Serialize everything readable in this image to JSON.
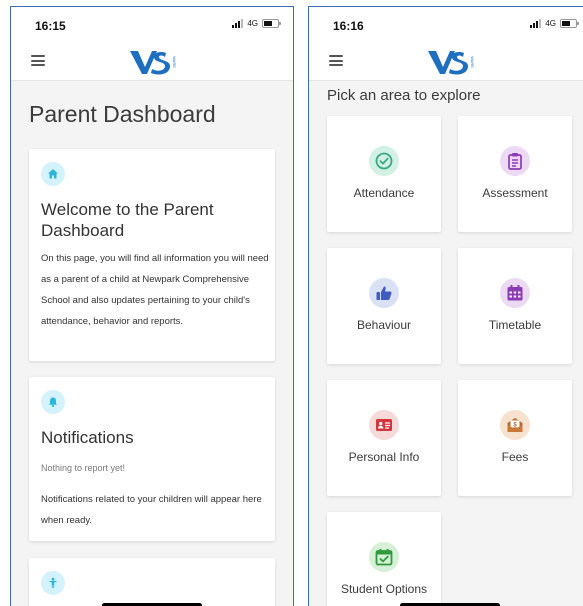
{
  "left_screen": {
    "status": {
      "time": "16:15",
      "network": "4G"
    },
    "page_title": "Parent Dashboard",
    "welcome_card": {
      "icon": "home-icon",
      "title": "Welcome to the Parent Dashboard",
      "body": "On this page, you will find all information you will need as a parent of a child at Newpark Comprehensive School and also updates pertaining to your child's attendance, behavior and reports."
    },
    "notifications_card": {
      "icon": "bell-icon",
      "title": "Notifications",
      "status_text": "Nothing to report yet!",
      "body": "Notifications related to your children will appear here when ready."
    },
    "third_card": {
      "icon": "child-icon"
    }
  },
  "right_screen": {
    "status": {
      "time": "16:16",
      "network": "4G"
    },
    "heading": "Pick an area to explore",
    "tiles": [
      {
        "label": "Attendance",
        "icon": "check-circle-icon",
        "color": "#3aa884",
        "bg": "#d3f0e5"
      },
      {
        "label": "Assessment",
        "icon": "clipboard-icon",
        "color": "#8b3bb5",
        "bg": "#ecdaf4"
      },
      {
        "label": "Behaviour",
        "icon": "thumbs-up-icon",
        "color": "#3f5bbf",
        "bg": "#dbe1f5"
      },
      {
        "label": "Timetable",
        "icon": "calendar-icon",
        "color": "#8b3bb5",
        "bg": "#ecdaf4"
      },
      {
        "label": "Personal Info",
        "icon": "id-card-icon",
        "color": "#d6363b",
        "bg": "#f6dada"
      },
      {
        "label": "Fees",
        "icon": "money-envelope-icon",
        "color": "#b9692c",
        "bg": "#f7e2d0"
      },
      {
        "label": "Student Options",
        "icon": "calendar-check-icon",
        "color": "#2f9a3b",
        "bg": "#d6f0d8"
      }
    ]
  },
  "colors": {
    "logo": "#1f6fc0",
    "card_icon_bg": "#d4f2fb",
    "card_icon": "#2cb5dc"
  }
}
